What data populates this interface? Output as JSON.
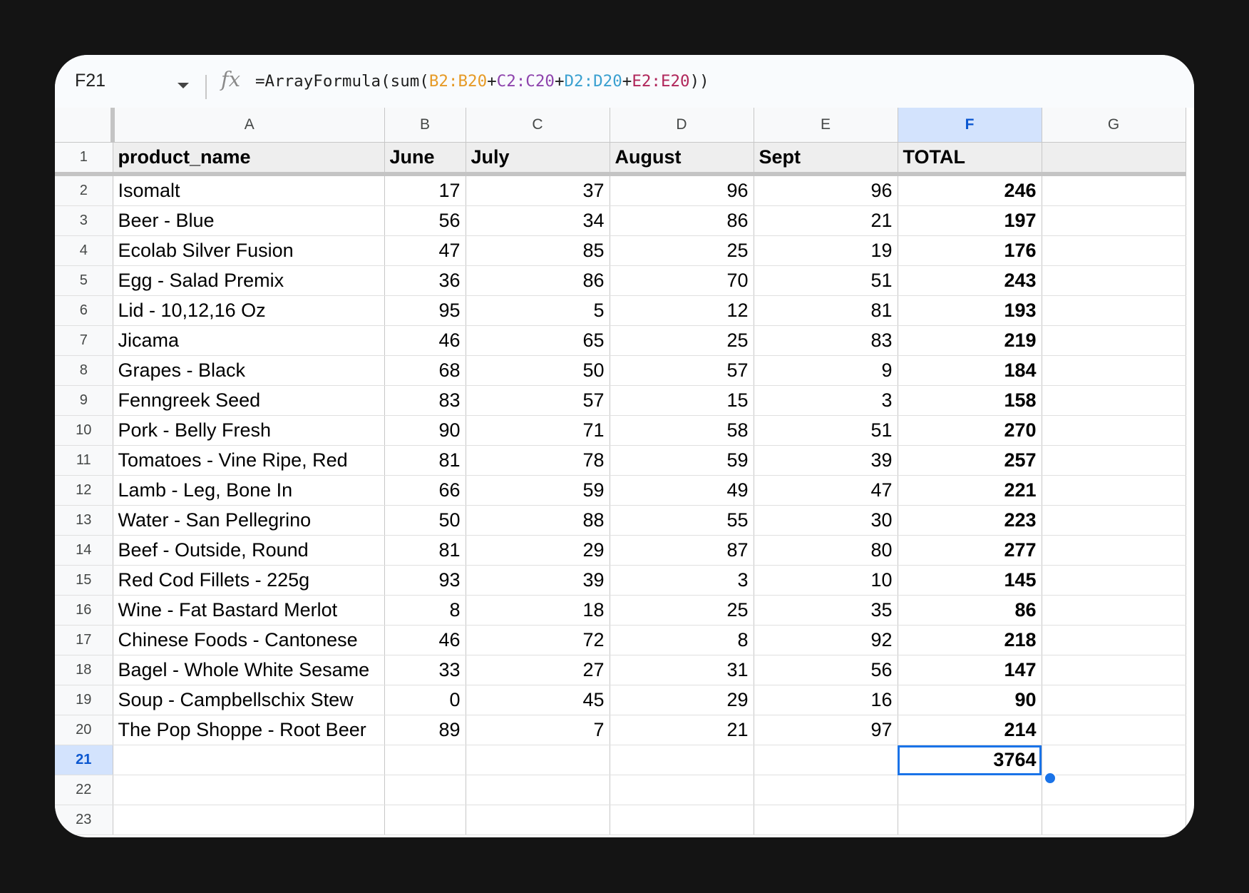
{
  "formula_bar": {
    "name_box": "F21",
    "fx_icon": "fx-icon",
    "formula_parts": [
      {
        "text": "=ArrayFormula(sum(",
        "color": "#1f1f1f"
      },
      {
        "text": "B2:B20",
        "color": "#e69a26"
      },
      {
        "text": "+",
        "color": "#1f1f1f"
      },
      {
        "text": "C2:C20",
        "color": "#8e44ad"
      },
      {
        "text": "+",
        "color": "#1f1f1f"
      },
      {
        "text": "D2:D20",
        "color": "#3aa0d0"
      },
      {
        "text": "+",
        "color": "#1f1f1f"
      },
      {
        "text": "E2:E20",
        "color": "#b0265a"
      },
      {
        "text": "))",
        "color": "#1f1f1f"
      }
    ]
  },
  "columns": [
    "A",
    "B",
    "C",
    "D",
    "E",
    "F",
    "G"
  ],
  "selected_column": "F",
  "header_row": {
    "row": "1",
    "cells": [
      "product_name",
      "June",
      "July",
      "August",
      "Sept",
      "TOTAL",
      ""
    ]
  },
  "rows": [
    {
      "row": "2",
      "product": "Isomalt",
      "june": "17",
      "july": "37",
      "august": "96",
      "sept": "96",
      "total": "246"
    },
    {
      "row": "3",
      "product": "Beer - Blue",
      "june": "56",
      "july": "34",
      "august": "86",
      "sept": "21",
      "total": "197"
    },
    {
      "row": "4",
      "product": "Ecolab Silver Fusion",
      "june": "47",
      "july": "85",
      "august": "25",
      "sept": "19",
      "total": "176"
    },
    {
      "row": "5",
      "product": "Egg - Salad Premix",
      "june": "36",
      "july": "86",
      "august": "70",
      "sept": "51",
      "total": "243"
    },
    {
      "row": "6",
      "product": "Lid - 10,12,16 Oz",
      "june": "95",
      "july": "5",
      "august": "12",
      "sept": "81",
      "total": "193"
    },
    {
      "row": "7",
      "product": "Jicama",
      "june": "46",
      "july": "65",
      "august": "25",
      "sept": "83",
      "total": "219"
    },
    {
      "row": "8",
      "product": "Grapes - Black",
      "june": "68",
      "july": "50",
      "august": "57",
      "sept": "9",
      "total": "184"
    },
    {
      "row": "9",
      "product": "Fenngreek Seed",
      "june": "83",
      "july": "57",
      "august": "15",
      "sept": "3",
      "total": "158"
    },
    {
      "row": "10",
      "product": "Pork - Belly Fresh",
      "june": "90",
      "july": "71",
      "august": "58",
      "sept": "51",
      "total": "270"
    },
    {
      "row": "11",
      "product": "Tomatoes - Vine Ripe, Red",
      "june": "81",
      "july": "78",
      "august": "59",
      "sept": "39",
      "total": "257"
    },
    {
      "row": "12",
      "product": "Lamb - Leg, Bone In",
      "june": "66",
      "july": "59",
      "august": "49",
      "sept": "47",
      "total": "221"
    },
    {
      "row": "13",
      "product": "Water - San Pellegrino",
      "june": "50",
      "july": "88",
      "august": "55",
      "sept": "30",
      "total": "223"
    },
    {
      "row": "14",
      "product": "Beef - Outside, Round",
      "june": "81",
      "july": "29",
      "august": "87",
      "sept": "80",
      "total": "277"
    },
    {
      "row": "15",
      "product": "Red Cod Fillets - 225g",
      "june": "93",
      "july": "39",
      "august": "3",
      "sept": "10",
      "total": "145"
    },
    {
      "row": "16",
      "product": "Wine - Fat Bastard Merlot",
      "june": "8",
      "july": "18",
      "august": "25",
      "sept": "35",
      "total": "86"
    },
    {
      "row": "17",
      "product": "Chinese Foods - Cantonese",
      "june": "46",
      "july": "72",
      "august": "8",
      "sept": "92",
      "total": "218"
    },
    {
      "row": "18",
      "product": "Bagel - Whole White Sesame",
      "june": "33",
      "july": "27",
      "august": "31",
      "sept": "56",
      "total": "147"
    },
    {
      "row": "19",
      "product": "Soup - Campbellschix Stew",
      "june": "0",
      "july": "45",
      "august": "29",
      "sept": "16",
      "total": "90"
    },
    {
      "row": "20",
      "product": "The Pop Shoppe - Root Beer",
      "june": "89",
      "july": "7",
      "august": "21",
      "sept": "97",
      "total": "214"
    }
  ],
  "total_row": {
    "row": "21",
    "value": "3764",
    "selected": true
  },
  "empty_rows": [
    "22",
    "23"
  ],
  "colors": {
    "selection": "#1a73e8",
    "header_selected_bg": "#d3e3fd"
  }
}
